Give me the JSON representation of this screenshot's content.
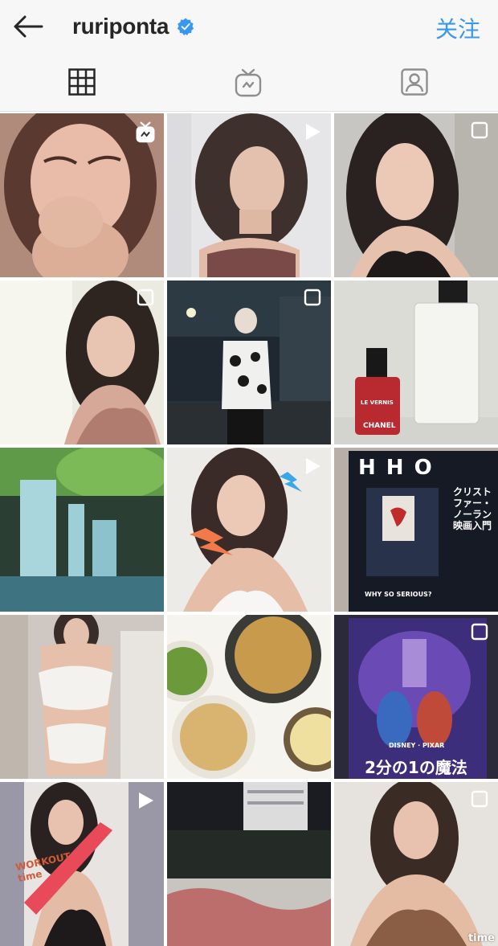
{
  "header": {
    "username": "ruriponta",
    "follow_label": "关注",
    "verified": true,
    "accent_color": "#3897f0"
  },
  "tabs": [
    {
      "icon": "grid-icon",
      "active": true
    },
    {
      "icon": "igtv-icon",
      "active": false
    },
    {
      "icon": "tagged-icon",
      "active": false
    }
  ],
  "posts": [
    {
      "row": 1,
      "col": 1,
      "badge": "igtv-icon"
    },
    {
      "row": 1,
      "col": 2,
      "badge": "video-icon"
    },
    {
      "row": 1,
      "col": 3,
      "badge": "carousel-icon"
    },
    {
      "row": 2,
      "col": 1,
      "badge": "carousel-icon"
    },
    {
      "row": 2,
      "col": 2,
      "badge": "carousel-icon"
    },
    {
      "row": 2,
      "col": 3,
      "badge": "",
      "bottle_text": "LE VERNIS",
      "brand_text": "CHANEL"
    },
    {
      "row": 3,
      "col": 1,
      "badge": ""
    },
    {
      "row": 3,
      "col": 2,
      "badge": "video-icon"
    },
    {
      "row": 3,
      "col": 3,
      "badge": "",
      "magazine_title": "H H O",
      "magazine_caption": "WHY SO SERIOUS?",
      "magazine_jp": "クリストファー・ノーラン映画入門"
    },
    {
      "row": 4,
      "col": 1,
      "badge": ""
    },
    {
      "row": 4,
      "col": 2,
      "badge": ""
    },
    {
      "row": 4,
      "col": 3,
      "badge": "carousel-icon",
      "poster_brand": "DISNEY · PIXAR",
      "poster_title": "2分の1の魔法"
    },
    {
      "row": 5,
      "col": 1,
      "badge": "video-icon",
      "sticker_text": "WORKOUT time"
    },
    {
      "row": 5,
      "col": 2,
      "badge": ""
    },
    {
      "row": 5,
      "col": 3,
      "badge": "carousel-icon"
    }
  ],
  "watermark": "time"
}
